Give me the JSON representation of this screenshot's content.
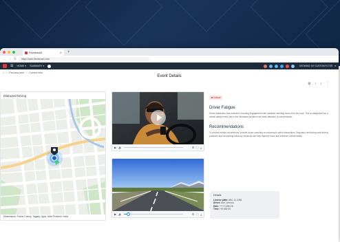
{
  "browser": {
    "tab_title": "Fleetsmart",
    "url": "https://web.fleetsmart.com"
  },
  "appbar": {
    "menu_home": "HOME",
    "menu_summary": "SUMMARY",
    "filter_label": "SHOWING: MY CUSTOM FILTER",
    "accent": "#d43b3b"
  },
  "breadcrumb": {
    "previous": "Previous item",
    "current": "Current item"
  },
  "page": {
    "title": "Event Details"
  },
  "map": {
    "title": "Distracted Driving",
    "address": "Dharmapuri, Forest Colony, Tajganj, Agra, Uttar Pradesh, India"
  },
  "videos": {
    "driver_cam_progress": 0.0,
    "road_cam_progress": 0.08
  },
  "event": {
    "severity": "Critical",
    "title": "Driver Fatigue",
    "description": "Driver distraction was detected, including engagement with activities diverting focus from the road. This is categorized as a critical safety event due to the increased accident risk when attention is compromised.",
    "recommendations_title": "Recommendations",
    "recommendations": "To prevent similar occurrences, provide driver coaching on reducing in-cabin distractions. Regularly reinforcing safe driving practices and conducting follow-up sessions can help improve focus and enhance overall safety."
  },
  "details": {
    "title": "Details",
    "license_label": "License plate:",
    "license_value": "ABC-12-3456",
    "driver_label": "Driver:",
    "driver_value": "Alex Johnson",
    "date_label": "Date:",
    "date_value": "YYYY-MM-DD",
    "time_label": "Time:",
    "time_value": "HH:MM:SS"
  }
}
